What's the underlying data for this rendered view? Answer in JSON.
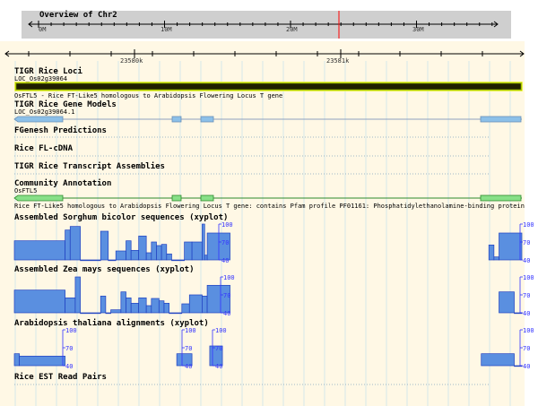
{
  "overview": {
    "title": "Overview of Chr2",
    "ticks": [
      "0M",
      "10M",
      "20M",
      "30M"
    ]
  },
  "detail_scale": {
    "ticks": [
      "23580k",
      "23581k"
    ]
  },
  "tracks": {
    "rice_loci": {
      "title": "TIGR Rice Loci",
      "feature_id": "LOC_Os02g39064",
      "description": "OsFTL5 - Rice FT-Like5 homologous to Arabidopsis Flowering Locus T gene"
    },
    "gene_models": {
      "title": "TIGR Rice Gene Models",
      "feature_id": "LOC_Os02g39064.1"
    },
    "fgenesh": {
      "title": "FGenesh Predictions"
    },
    "fl_cdna": {
      "title": "Rice FL-cDNA"
    },
    "transcript_assemblies": {
      "title": "TIGR Rice Transcript Assemblies"
    },
    "community_annotation": {
      "title": "Community Annotation",
      "feature_id": "OsFTL5",
      "description": "Rice FT-Like5 homologous to Arabidopsis Flowering Locus T gene: contains Pfam profile PF01161: Phosphatidylethanolamine-binding protein"
    },
    "sorghum": {
      "title": "Assembled Sorghum bicolor sequences (xyplot)"
    },
    "zea": {
      "title": "Assembled Zea mays sequences (xyplot)"
    },
    "arabidopsis": {
      "title": "Arabidopsis thaliana alignments (xyplot)"
    },
    "est": {
      "title": "Rice EST Read Pairs"
    }
  },
  "xyplot_scale": {
    "max": "100",
    "mid": "70",
    "min": "40"
  },
  "chart_data": [
    {
      "type": "bar",
      "series": [
        {
          "name": "Assembled Sorghum bicolor sequences (xyplot)",
          "values": [
            {
              "start": 0.0,
              "end": 0.1,
              "y": 72
            },
            {
              "start": 0.1,
              "end": 0.11,
              "y": 90
            },
            {
              "start": 0.11,
              "end": 0.13,
              "y": 96
            },
            {
              "start": 0.13,
              "end": 0.17,
              "y": 40
            },
            {
              "start": 0.17,
              "end": 0.185,
              "y": 88
            },
            {
              "start": 0.185,
              "end": 0.2,
              "y": 40
            },
            {
              "start": 0.2,
              "end": 0.22,
              "y": 55
            },
            {
              "start": 0.22,
              "end": 0.23,
              "y": 72
            },
            {
              "start": 0.23,
              "end": 0.245,
              "y": 56
            },
            {
              "start": 0.245,
              "end": 0.26,
              "y": 80
            },
            {
              "start": 0.26,
              "end": 0.27,
              "y": 52
            },
            {
              "start": 0.27,
              "end": 0.28,
              "y": 70
            },
            {
              "start": 0.28,
              "end": 0.29,
              "y": 64
            },
            {
              "start": 0.29,
              "end": 0.3,
              "y": 66
            },
            {
              "start": 0.3,
              "end": 0.31,
              "y": 50
            },
            {
              "start": 0.31,
              "end": 0.335,
              "y": 40
            },
            {
              "start": 0.335,
              "end": 0.35,
              "y": 70
            },
            {
              "start": 0.35,
              "end": 0.37,
              "y": 70
            },
            {
              "start": 0.37,
              "end": 0.375,
              "y": 100
            },
            {
              "start": 0.375,
              "end": 0.38,
              "y": 48
            },
            {
              "start": 0.38,
              "end": 0.425,
              "y": 85
            },
            {
              "start": 0.935,
              "end": 0.945,
              "y": 65
            },
            {
              "start": 0.945,
              "end": 0.955,
              "y": 45
            },
            {
              "start": 0.955,
              "end": 1.0,
              "y": 85
            }
          ]
        }
      ]
    },
    {
      "type": "bar",
      "series": [
        {
          "name": "Assembled Zea mays sequences (xyplot)",
          "values": [
            {
              "start": 0.0,
              "end": 0.1,
              "y": 78
            },
            {
              "start": 0.1,
              "end": 0.12,
              "y": 65
            },
            {
              "start": 0.12,
              "end": 0.13,
              "y": 100
            },
            {
              "start": 0.13,
              "end": 0.17,
              "y": 40
            },
            {
              "start": 0.17,
              "end": 0.18,
              "y": 68
            },
            {
              "start": 0.18,
              "end": 0.19,
              "y": 40
            },
            {
              "start": 0.19,
              "end": 0.21,
              "y": 45
            },
            {
              "start": 0.21,
              "end": 0.22,
              "y": 75
            },
            {
              "start": 0.22,
              "end": 0.23,
              "y": 65
            },
            {
              "start": 0.23,
              "end": 0.245,
              "y": 56
            },
            {
              "start": 0.245,
              "end": 0.26,
              "y": 65
            },
            {
              "start": 0.26,
              "end": 0.27,
              "y": 52
            },
            {
              "start": 0.27,
              "end": 0.285,
              "y": 64
            },
            {
              "start": 0.285,
              "end": 0.295,
              "y": 60
            },
            {
              "start": 0.295,
              "end": 0.305,
              "y": 56
            },
            {
              "start": 0.305,
              "end": 0.33,
              "y": 40
            },
            {
              "start": 0.33,
              "end": 0.345,
              "y": 55
            },
            {
              "start": 0.345,
              "end": 0.37,
              "y": 70
            },
            {
              "start": 0.37,
              "end": 0.38,
              "y": 68
            },
            {
              "start": 0.38,
              "end": 0.425,
              "y": 86
            },
            {
              "start": 0.955,
              "end": 0.985,
              "y": 75
            },
            {
              "start": 0.985,
              "end": 1.0,
              "y": 40
            }
          ]
        }
      ]
    },
    {
      "type": "bar",
      "series": [
        {
          "name": "Arabidopsis thaliana alignments (xyplot)",
          "values": [
            {
              "start": 0.0,
              "end": 0.01,
              "y": 60
            },
            {
              "start": 0.01,
              "end": 0.1,
              "y": 56
            },
            {
              "start": 0.32,
              "end": 0.35,
              "y": 60
            },
            {
              "start": 0.385,
              "end": 0.41,
              "y": 73
            },
            {
              "start": 0.92,
              "end": 0.985,
              "y": 60
            },
            {
              "start": 0.985,
              "end": 1.0,
              "y": 40
            }
          ]
        }
      ]
    }
  ],
  "colors": {
    "overview_bg": "#cfcfcf",
    "track_bg": "#fff8e5",
    "grid": "#b9dcec",
    "locus_fill": "#1f1f00",
    "locus_border": "#a6c400",
    "locus_highlight": "#ffff66",
    "gene_model": "#8cc0e8",
    "gene_model_line": "#8ca0c0",
    "community_fill": "#88e088",
    "community_line": "#2c8a2c",
    "xyplot_fill": "#5a8fe0",
    "xyplot_stroke": "#1f40c0",
    "scale_text": "#3333ff",
    "overview_marker": "#ff0000"
  }
}
